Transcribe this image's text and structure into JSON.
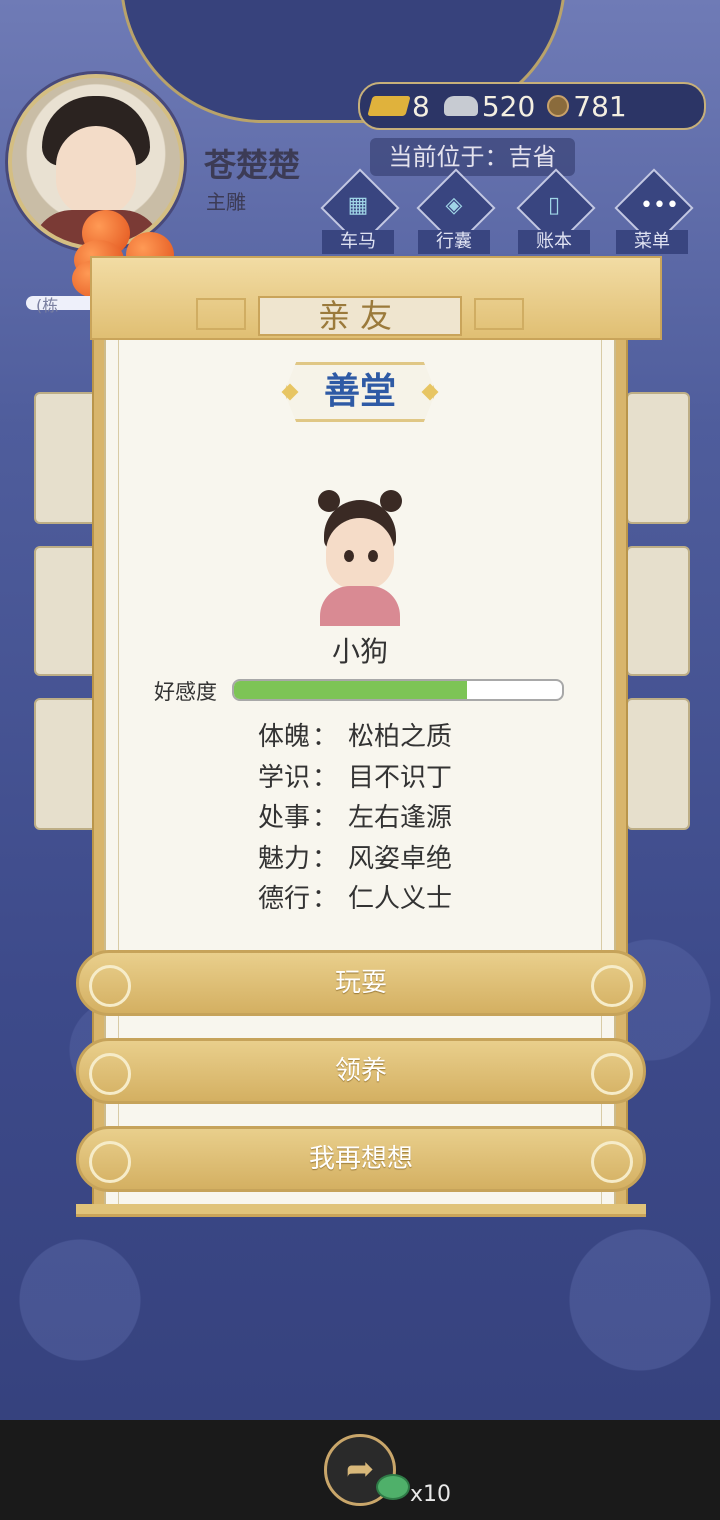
{
  "player": {
    "name": "苍楚楚",
    "role": "主雕"
  },
  "currency": {
    "gold": "8",
    "silver": "520",
    "coins": "781",
    "gold_icon": "gold-ingot-icon",
    "silver_icon": "silver-ingot-icon",
    "coin_icon": "copper-coin-icon"
  },
  "location": {
    "text": "当前位于：吉省"
  },
  "nav": [
    {
      "label": "车马",
      "icon": "carriage-icon"
    },
    {
      "label": "行囊",
      "icon": "bundle-icon"
    },
    {
      "label": "账本",
      "icon": "ledger-icon"
    },
    {
      "label": "菜单",
      "icon": "menu-dots-icon"
    }
  ],
  "quest": {
    "label": "(栋"
  },
  "modal": {
    "header": "亲友",
    "place": "善堂",
    "npc_name": "小狗",
    "favor_label": "好感度",
    "favor_value": 0.71,
    "attributes": [
      {
        "key": "体魄",
        "value": "松柏之质"
      },
      {
        "key": "学识",
        "value": "目不识丁"
      },
      {
        "key": "处事",
        "value": "左右逢源"
      },
      {
        "key": "魅力",
        "value": "风姿卓绝"
      },
      {
        "key": "德行",
        "value": "仁人义士"
      }
    ],
    "separator": "：",
    "buttons": {
      "play": "玩耍",
      "adopt": "领养",
      "think": "我再想想"
    }
  },
  "share": {
    "count": "x10",
    "icon": "share-arrow-icon",
    "reward_icon": "jade-reward-icon"
  },
  "colors": {
    "accent_gold": "#d4b062",
    "title_blue": "#2e5aa5",
    "favor_green": "#7dc456",
    "bg_indigo": "#3d4a86"
  }
}
